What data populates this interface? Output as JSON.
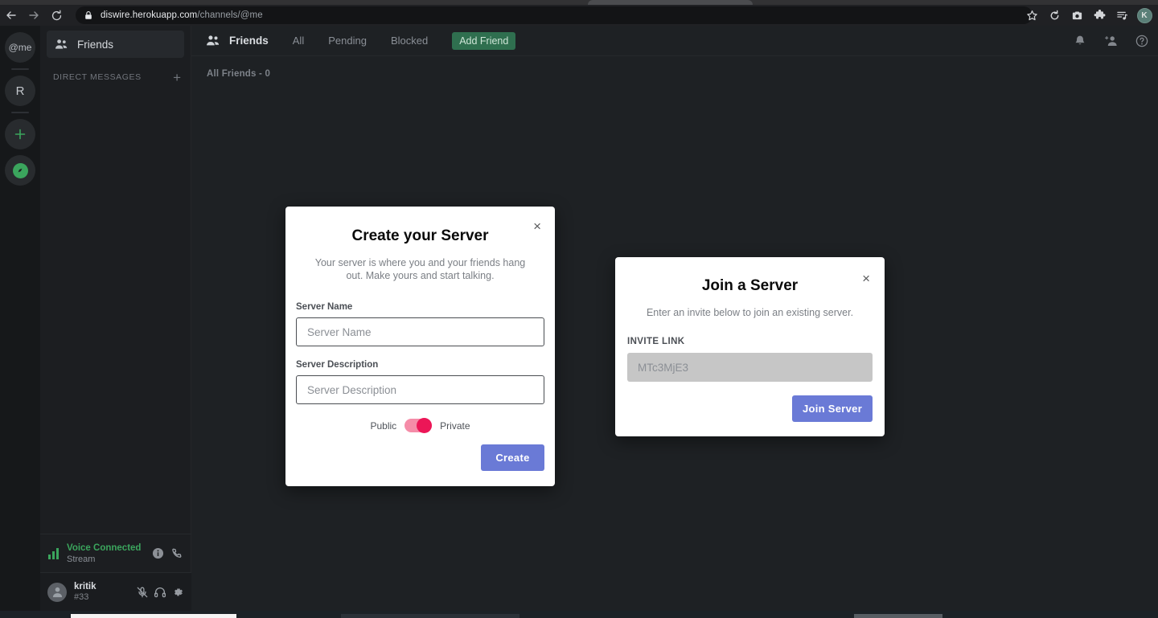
{
  "browser": {
    "back_icon": "back-arrow-icon",
    "forward_icon": "forward-arrow-icon",
    "reload_icon": "reload-icon",
    "url_domain": "diswire.herokuapp.com",
    "url_path": "/channels/@me",
    "bookmark_icon": "star-icon",
    "extensions": [
      "tab-sync-icon",
      "screenshot-icon",
      "puzzle-icon",
      "reading-list-icon"
    ],
    "profile_initial": "K"
  },
  "server_rail": {
    "items": [
      {
        "name": "home-dm-button",
        "label": "@me"
      },
      {
        "name": "server-button-r",
        "label": "R"
      },
      {
        "name": "add-server-button",
        "label": "+"
      },
      {
        "name": "explore-servers-button",
        "label": "compass-icon"
      }
    ]
  },
  "sidebar": {
    "friends_label": "Friends",
    "dm_header": "DIRECT MESSAGES",
    "dm_add_label": "+",
    "voice": {
      "status": "Voice Connected",
      "channel": "Stream",
      "info_icon": "info-icon",
      "call_icon": "phone-icon"
    },
    "user": {
      "name": "kritik",
      "tag": "#33",
      "mute_icon": "mic-muted-icon",
      "deafen_icon": "headphones-icon",
      "settings_icon": "gear-icon"
    }
  },
  "main": {
    "topbar_title": "Friends",
    "tabs": [
      "All",
      "Pending",
      "Blocked"
    ],
    "add_friend_label": "Add Friend",
    "icons": [
      "bell-icon",
      "add-friend-icon",
      "help-icon"
    ],
    "friends_count_label": "All Friends - 0"
  },
  "create_modal": {
    "title": "Create your Server",
    "subtitle": "Your server is where you and your friends hang out. Make yours and start talking.",
    "close_label": "×",
    "name_label": "Server Name",
    "name_value": "",
    "name_placeholder": "Server Name",
    "desc_label": "Server Description",
    "desc_value": "",
    "desc_placeholder": "Server Description",
    "toggle_left": "Public",
    "toggle_right": "Private",
    "toggle_state": "Private",
    "submit_label": "Create",
    "accent_color": "#6a7ad6",
    "toggle_knob_color": "#ec1657",
    "toggle_track_color": "#f58ca8"
  },
  "join_modal": {
    "title": "Join a Server",
    "subtitle": "Enter an invite below to join an existing server.",
    "close_label": "×",
    "invite_label": "INVITE LINK",
    "invite_value": "MTc3MjE3",
    "invite_placeholder": "MTc3MjE3",
    "submit_label": "Join Server",
    "accent_color": "#6a7ad6"
  }
}
